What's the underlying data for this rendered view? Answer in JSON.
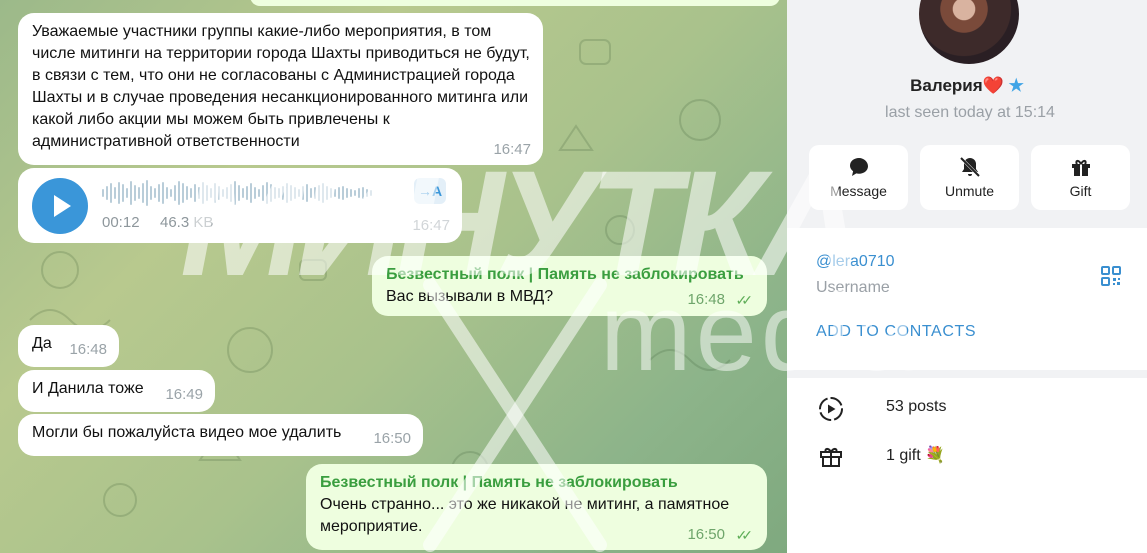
{
  "chat": {
    "messages": [
      {
        "id": "m1",
        "direction": "in",
        "text": "Уважаемые участники группы какие-либо мероприятия, в том числе митинги на территории города Шахты приводиться не будут, в связи с тем, что они не согласованы с Администрацией города Шахты и в случае проведения несанкционированного митинга или какой либо акции мы можем быть привлечены к административной ответственности",
        "time": "16:47"
      },
      {
        "id": "m2",
        "direction": "in",
        "type": "voice",
        "duration": "00:12",
        "size": "46.3 KB",
        "transcribe_label": "→A",
        "time": "16:47"
      },
      {
        "id": "m3",
        "direction": "out",
        "sender": "Безвестный полк | Память не заблокировать",
        "text": "Вас вызывали в МВД?",
        "time": "16:48"
      },
      {
        "id": "m4",
        "direction": "in",
        "text": "Да",
        "time": "16:48"
      },
      {
        "id": "m5",
        "direction": "in",
        "text": "И Данила тоже",
        "time": "16:49"
      },
      {
        "id": "m6",
        "direction": "in",
        "text": "Могли бы пожалуйста видео мое удалить",
        "time": "16:50"
      },
      {
        "id": "m7",
        "direction": "out",
        "sender": "Безвестный полк | Память не заблокировать",
        "text": "Очень странно... это же никакой не митинг, а памятное мероприятие.",
        "time": "16:50"
      }
    ],
    "colors": {
      "outgoing_bubble": "#eefedf",
      "sender_name": "#3a9e3f",
      "accent": "#3a96d9"
    }
  },
  "profile": {
    "name": "Валерия",
    "name_emoji": "❤️",
    "verified_icon": "star-icon",
    "last_seen": "last seen today at 15:14",
    "actions": [
      {
        "label": "Message",
        "icon": "chat-bubble-icon"
      },
      {
        "label": "Unmute",
        "icon": "bell-off-icon"
      },
      {
        "label": "Gift",
        "icon": "gift-icon"
      }
    ],
    "username": "@lera0710",
    "username_label": "Username",
    "add_to_contacts": "ADD TO CONTACTS",
    "posts": "53 posts",
    "gifts": "1 gift",
    "gift_emoji": "💐"
  },
  "watermark": {
    "text_top": "МИНУТКА",
    "text_media": "media"
  }
}
